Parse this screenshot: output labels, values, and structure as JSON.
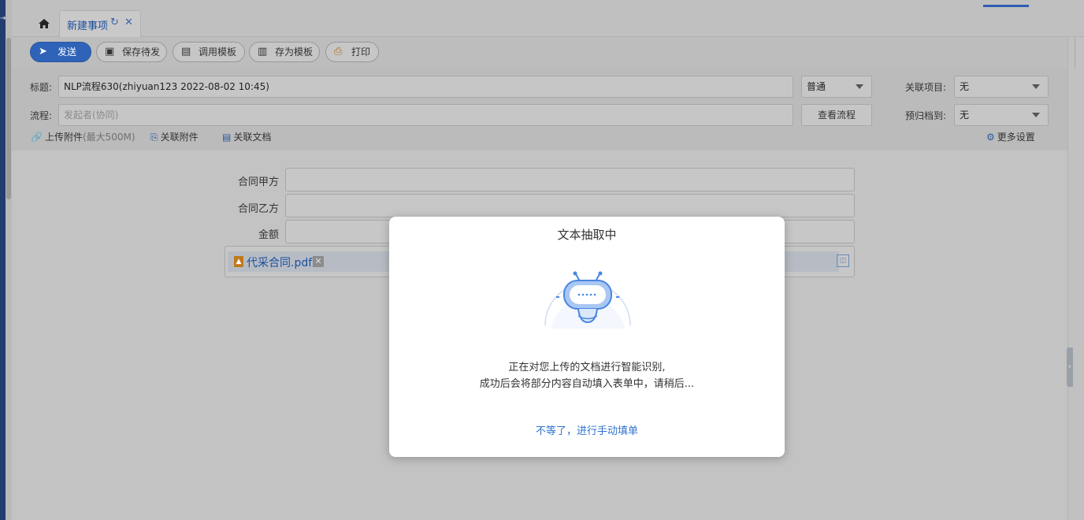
{
  "tabs": [
    {
      "label": "新建事项"
    }
  ],
  "toolbar": {
    "send": "发送",
    "save_draft": "保存待发",
    "use_template": "调用模板",
    "save_template": "存为模板",
    "print": "打印"
  },
  "form_header": {
    "title_label": "标题:",
    "title_value": "NLP流程630(zhiyuan123 2022-08-02 10:45)",
    "priority_value": "普通",
    "related_project_label": "关联项目:",
    "related_project_value": "无",
    "flow_label": "流程:",
    "flow_placeholder": "发起者(协同)",
    "view_flow_button": "查看流程",
    "archive_label": "预归档到:",
    "archive_value": "无",
    "upload_attachment": "上传附件",
    "upload_limit": "(最大500M)",
    "link_attachment": "关联附件",
    "link_document": "关联文档",
    "more_settings": "更多设置"
  },
  "form_body": {
    "party_a_label": "合同甲方",
    "party_b_label": "合同乙方",
    "amount_label": "金额",
    "attachment_name": "代采合同.pdf"
  },
  "modal": {
    "title": "文本抽取中",
    "message_line1": "正在对您上传的文档进行智能识别,",
    "message_line2": "成功后会将部分内容自动填入表单中，请稍后...",
    "manual_link": "不等了，进行手动填单"
  },
  "colors": {
    "accent": "#2f63b8",
    "link": "#2f73d0",
    "sidebar": "#233d6f"
  }
}
